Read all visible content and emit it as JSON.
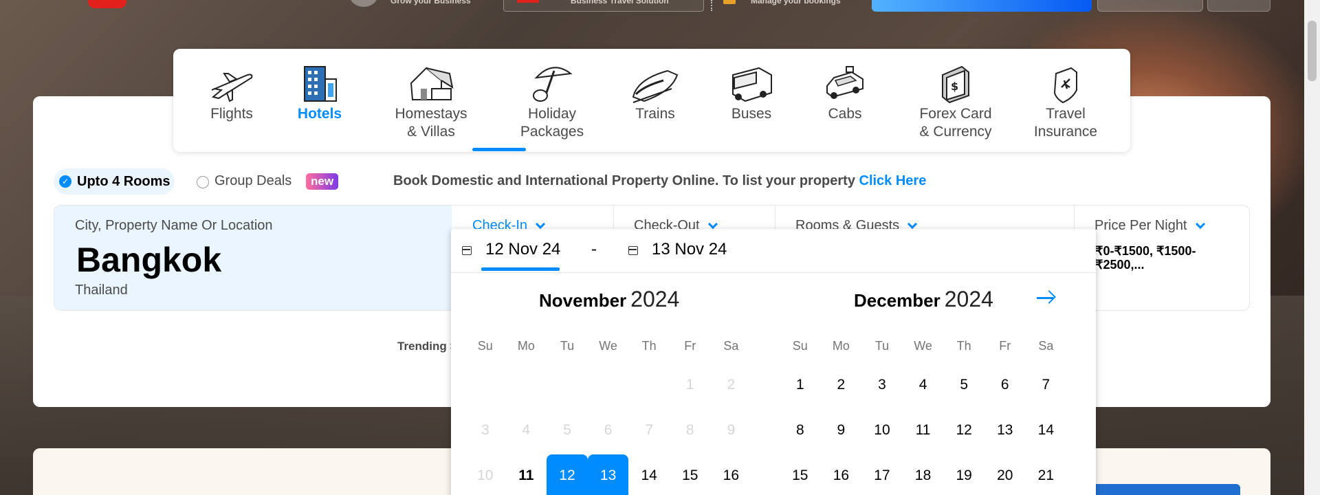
{
  "topbar": {
    "grow_text": "Grow your Business",
    "business_text": "Business Travel Solution",
    "bookings_text": "Manage your bookings"
  },
  "nav": {
    "tabs": [
      {
        "label": "Flights",
        "icon": "plane-icon"
      },
      {
        "label": "Hotels",
        "icon": "hotel-icon",
        "active": true
      },
      {
        "label": "Homestays\n& Villas",
        "icon": "house-icon"
      },
      {
        "label": "Holiday\nPackages",
        "icon": "umbrella-icon"
      },
      {
        "label": "Trains",
        "icon": "train-icon"
      },
      {
        "label": "Buses",
        "icon": "bus-icon"
      },
      {
        "label": "Cabs",
        "icon": "car-icon"
      },
      {
        "label": "Forex Card\n& Currency",
        "icon": "forex-icon"
      },
      {
        "label": "Travel\nInsurance",
        "icon": "shield-plane-icon"
      }
    ]
  },
  "options": {
    "rooms_label": "Upto 4 Rooms",
    "group_label": "Group Deals",
    "new_badge": "new",
    "promo_text": "Book Domestic and International Property Online. To list your property ",
    "promo_link": "Click Here"
  },
  "search": {
    "city_label": "City, Property Name Or Location",
    "city_value": "Bangkok",
    "city_sub": "Thailand",
    "checkin_label": "Check-In",
    "checkout_label": "Check-Out",
    "guests_label": "Rooms & Guests",
    "price_label": "Price Per Night",
    "price_value": "₹0-₹1500, ₹1500-₹2500,..."
  },
  "trending": "Trending S",
  "picker": {
    "start_date": "12 Nov 24",
    "separator": "-",
    "end_date": "13 Nov 24",
    "weekdays": [
      "Su",
      "Mo",
      "Tu",
      "We",
      "Th",
      "Fr",
      "Sa"
    ],
    "months": [
      {
        "name": "November",
        "year": "2024",
        "days": [
          "",
          "",
          "",
          "",
          "",
          "1",
          "2",
          "3",
          "4",
          "5",
          "6",
          "7",
          "8",
          "9",
          "10",
          "11",
          "12",
          "13",
          "14",
          "15",
          "16"
        ],
        "disabled_until": "10",
        "today": "11",
        "selected": [
          "12",
          "13"
        ]
      },
      {
        "name": "December",
        "year": "2024",
        "days": [
          "1",
          "2",
          "3",
          "4",
          "5",
          "6",
          "7",
          "8",
          "9",
          "10",
          "11",
          "12",
          "13",
          "14",
          "15",
          "16",
          "17",
          "18",
          "19",
          "20",
          "21"
        ]
      }
    ]
  },
  "colors": {
    "accent": "#008cff",
    "brand_red": "#e2211c"
  }
}
